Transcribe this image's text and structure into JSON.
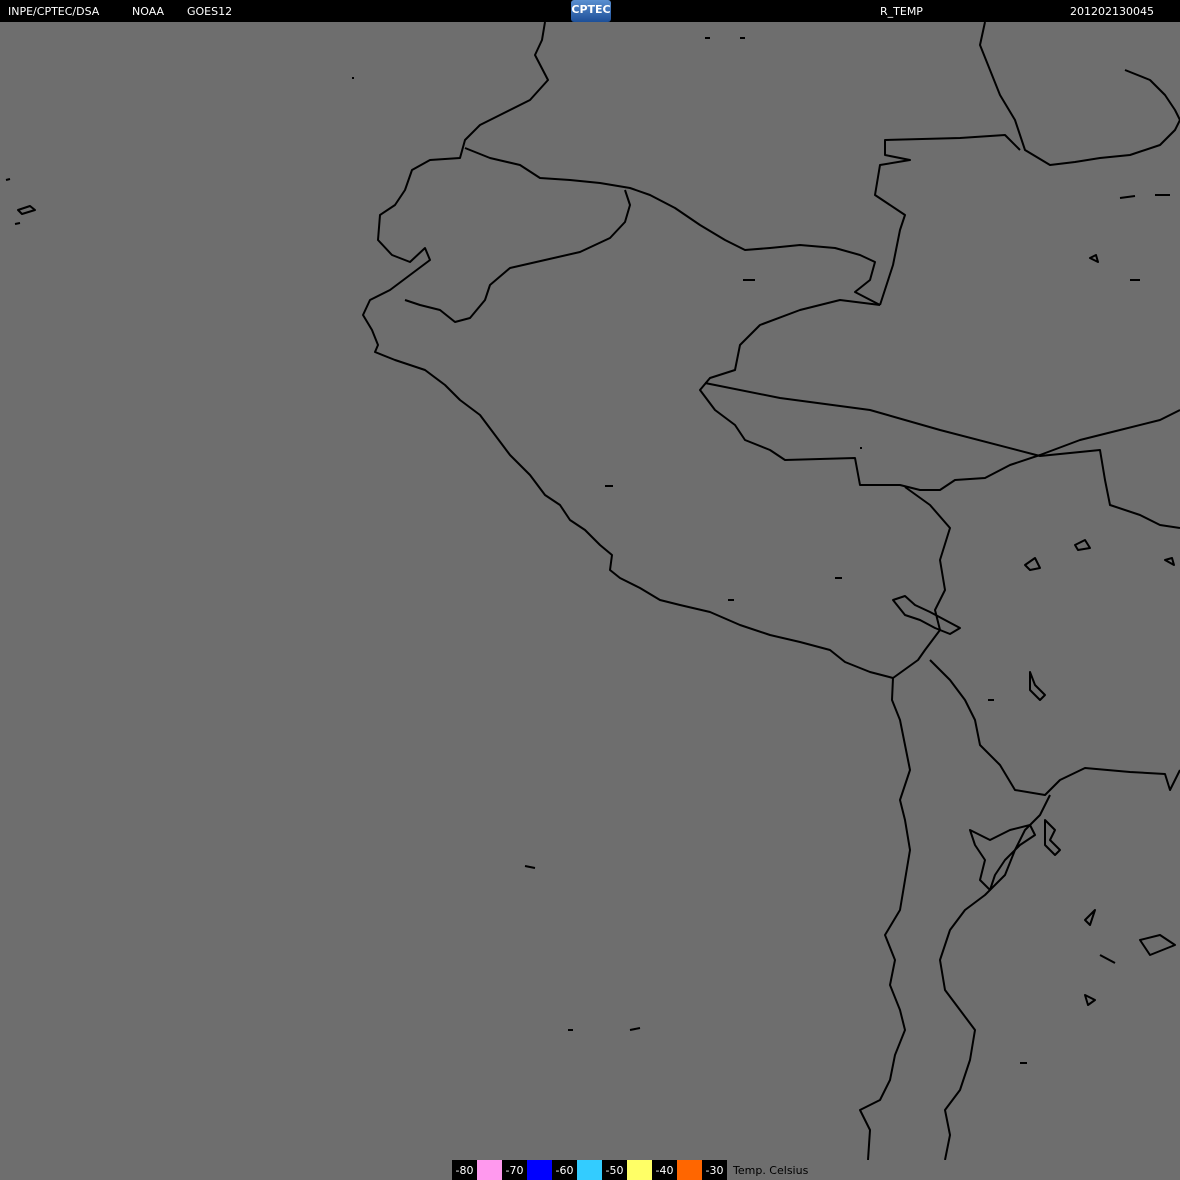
{
  "header": {
    "agency": "INPE/CPTEC/DSA",
    "source": "NOAA",
    "satellite": "GOES12",
    "logo_text": "CPTEC",
    "product": "R_TEMP",
    "timestamp": "201202130045"
  },
  "colors": {
    "background": "#6e6e6e",
    "coastline": "#000000",
    "bar": "#000000"
  },
  "legend": {
    "items": [
      {
        "label": "-80",
        "color": "#ff99ee"
      },
      {
        "label": "-70",
        "color": "#0000ff"
      },
      {
        "label": "-60",
        "color": "#33ccff"
      },
      {
        "label": "-50",
        "color": "#ffff66"
      },
      {
        "label": "-40",
        "color": "#ff6600"
      },
      {
        "label": "-30",
        "color": null
      }
    ],
    "unit": "Temp. Celsius"
  }
}
